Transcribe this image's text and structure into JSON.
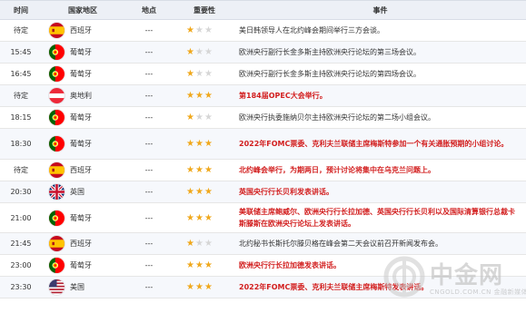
{
  "header": {
    "time": "时间",
    "country": "国家地区",
    "place": "地点",
    "importance": "重要性",
    "event": "事件"
  },
  "colors": {
    "star_on": "#f0a81c",
    "star_off": "#d6d6d6",
    "event_red": "#d21e1e",
    "header_bg": "#edf0f6"
  },
  "rows": [
    {
      "time": "待定",
      "country": "西班牙",
      "flag": "spain-flag",
      "place": "---",
      "stars": 1,
      "event": "美日韩领导人在北约峰会期间举行三方会谈。",
      "emphasis": false
    },
    {
      "time": "15:45",
      "country": "葡萄牙",
      "flag": "portugal-flag",
      "place": "---",
      "stars": 1,
      "event": "欧洲央行副行长金多斯主持欧洲央行论坛的第三场会议。",
      "emphasis": false
    },
    {
      "time": "16:45",
      "country": "葡萄牙",
      "flag": "portugal-flag",
      "place": "---",
      "stars": 1,
      "event": "欧洲央行副行长金多斯主持欧洲央行论坛的第四场会议。",
      "emphasis": false
    },
    {
      "time": "待定",
      "country": "奥地利",
      "flag": "austria-flag",
      "place": "---",
      "stars": 3,
      "event": "第184届OPEC大会举行。",
      "emphasis": true
    },
    {
      "time": "18:15",
      "country": "葡萄牙",
      "flag": "portugal-flag",
      "place": "---",
      "stars": 1,
      "event": "欧洲央行执委施纳贝尔主持欧洲央行论坛的第二场小组会议。",
      "emphasis": false
    },
    {
      "time": "18:30",
      "country": "葡萄牙",
      "flag": "portugal-flag",
      "place": "---",
      "stars": 3,
      "event": "2022年FOMC票委、克利夫兰联储主席梅斯特参加一个有关通胀预期的小组讨论。",
      "emphasis": true
    },
    {
      "time": "待定",
      "country": "西班牙",
      "flag": "spain-flag",
      "place": "---",
      "stars": 3,
      "event": "北约峰会举行，为期两日，预计讨论将集中在乌克兰问题上。",
      "emphasis": true
    },
    {
      "time": "20:30",
      "country": "英国",
      "flag": "uk-flag",
      "place": "---",
      "stars": 3,
      "event": "英国央行行长贝利发表讲话。",
      "emphasis": true
    },
    {
      "time": "21:00",
      "country": "葡萄牙",
      "flag": "portugal-flag",
      "place": "---",
      "stars": 3,
      "event": "美联储主席鲍威尔、欧洲央行行长拉加德、英国央行行长贝利以及国际清算银行总裁卡斯滕斯在欧洲央行论坛上发表讲话。",
      "emphasis": true
    },
    {
      "time": "21:45",
      "country": "西班牙",
      "flag": "spain-flag",
      "place": "---",
      "stars": 1,
      "event": "北约秘书长斯托尔滕贝格在峰会第二天会议前召开新闻发布会。",
      "emphasis": false
    },
    {
      "time": "23:00",
      "country": "葡萄牙",
      "flag": "portugal-flag",
      "place": "---",
      "stars": 3,
      "event": "欧洲央行行长拉加德发表讲话。",
      "emphasis": true
    },
    {
      "time": "23:30",
      "country": "美国",
      "flag": "usa-flag",
      "place": "---",
      "stars": 3,
      "event": "2022年FOMC票委、克利夫兰联储主席梅斯特发表讲话。",
      "emphasis": true
    }
  ],
  "watermark": {
    "title": "中金网",
    "subtitle": "CNGOLD.COM.CN 金融新媒体"
  }
}
